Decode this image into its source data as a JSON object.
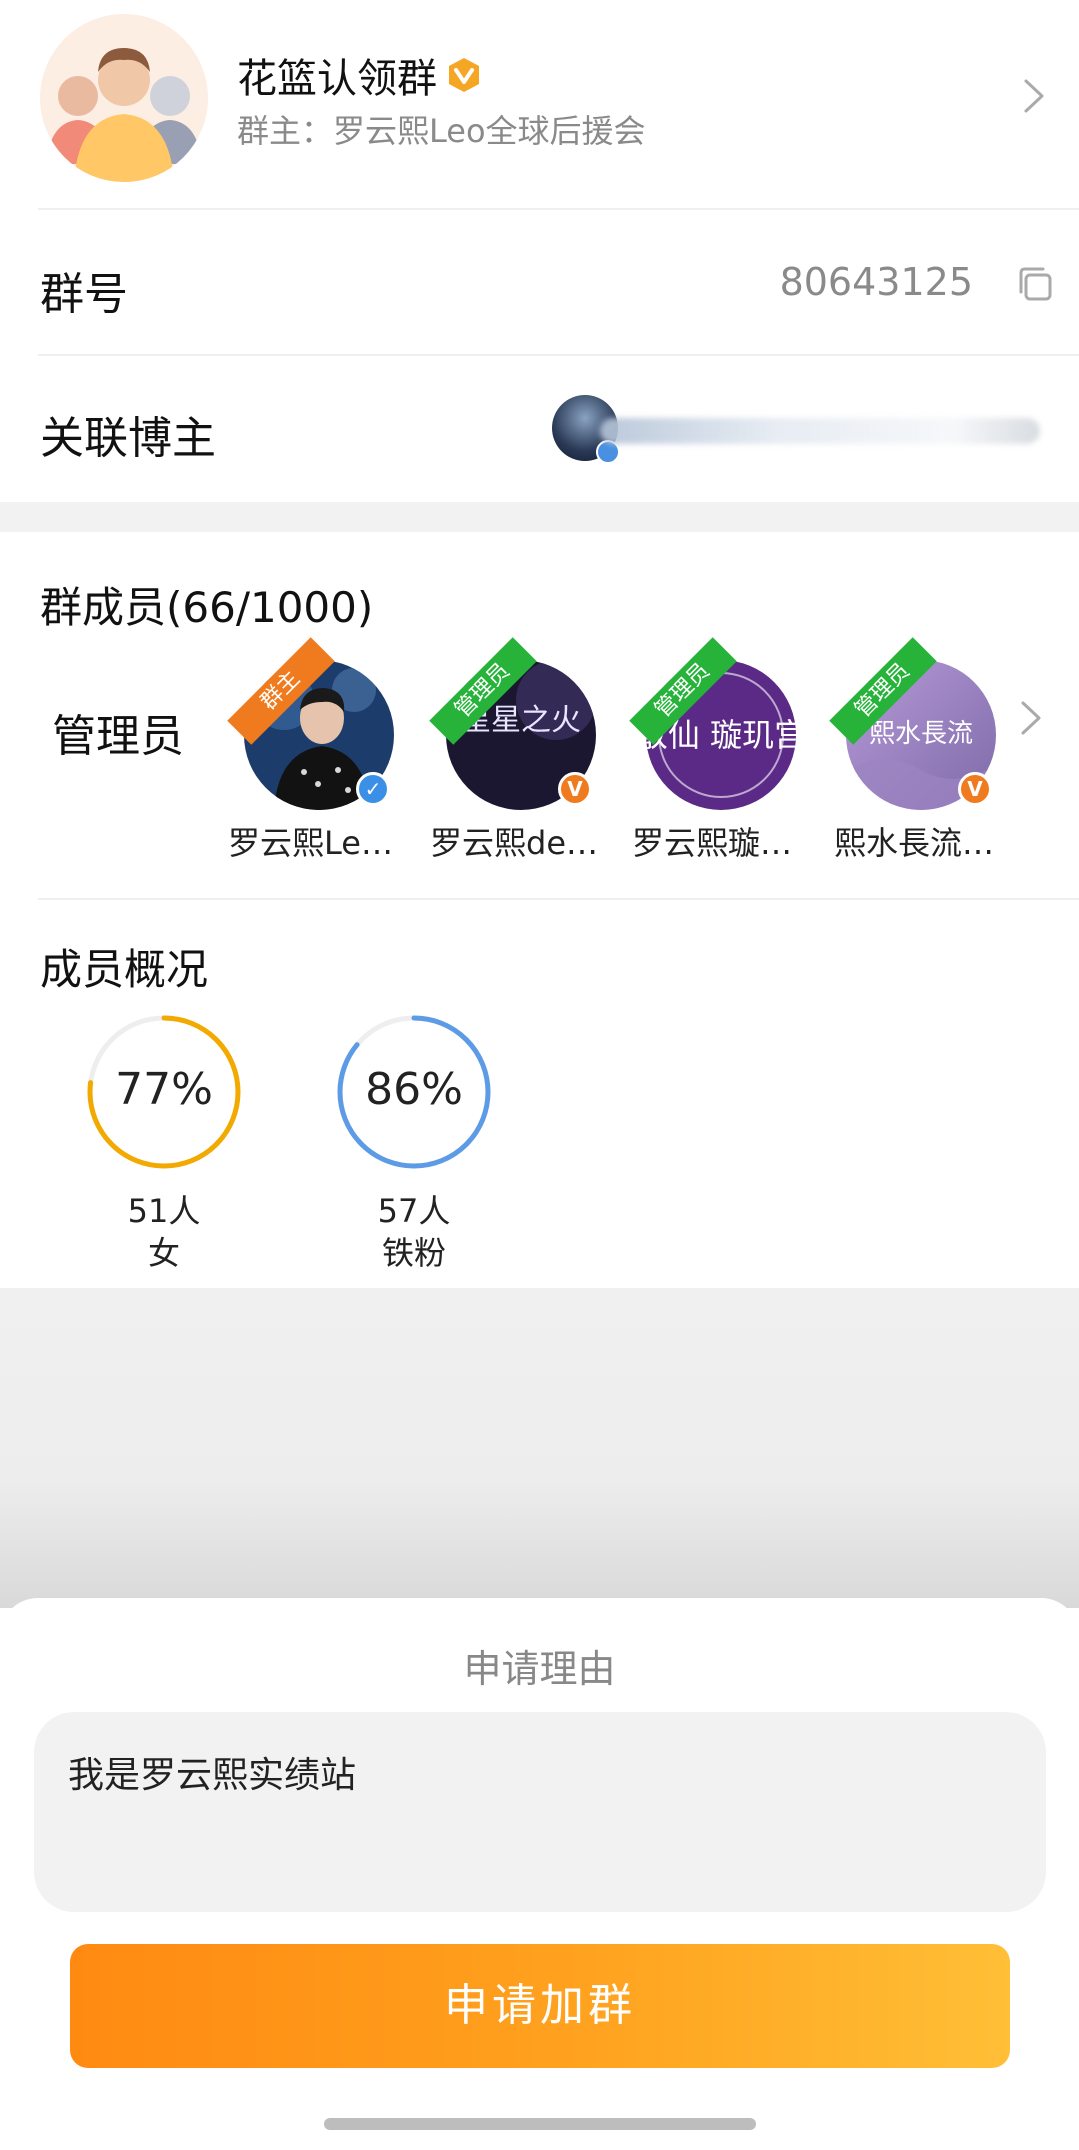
{
  "header": {
    "group_name": "花篮认领群",
    "owner_line": "群主：罗云熙Leo全球后援会"
  },
  "group_id": {
    "label": "群号",
    "value": "80643125"
  },
  "linked_blogger": {
    "label": "关联博主"
  },
  "members": {
    "title": "群成员(66/1000)",
    "admin_label": "管理员",
    "admins": [
      {
        "name": "罗云熙Le…",
        "ribbon": "群主",
        "badge": "blue",
        "avatar_text": ""
      },
      {
        "name": "罗云熙de…",
        "ribbon": "管理员",
        "badge": "orange",
        "avatar_text": "星星之火"
      },
      {
        "name": "罗云熙璇…",
        "ribbon": "管理员",
        "badge": "",
        "avatar_text": "散仙 璇玑宫"
      },
      {
        "name": "熙水長流…",
        "ribbon": "管理员",
        "badge": "orange",
        "avatar_text": "熙水長流"
      }
    ]
  },
  "overview": {
    "title": "成员概况",
    "stats": [
      {
        "percent": "77%",
        "fraction": 0.77,
        "count": "51人",
        "label": "女",
        "color": "#f2a900"
      },
      {
        "percent": "86%",
        "fraction": 0.86,
        "count": "57人",
        "label": "铁粉",
        "color": "#5d9be6"
      }
    ]
  },
  "sheet": {
    "title": "申请理由",
    "reason_text": "我是罗云熙实绩站",
    "apply_button": "申请加群"
  },
  "colors": {
    "accent_orange": "#ff8a12",
    "admin_green": "#27b33a",
    "owner_orange": "#f07a1e"
  }
}
